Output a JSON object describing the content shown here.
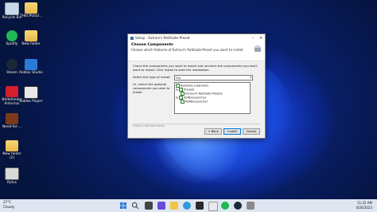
{
  "desktop": {
    "icons": [
      {
        "label": "Recycle Bin",
        "icon": "recycle-bin-icon"
      },
      {
        "label": "THECPUGU...",
        "icon": "folder-icon"
      },
      {
        "label": "Spotify",
        "icon": "spotify-icon"
      },
      {
        "label": "New folder",
        "icon": "folder-icon"
      },
      {
        "label": "Steam",
        "icon": "steam-icon"
      },
      {
        "label": "Roblox Studio",
        "icon": "roblox-studio-icon"
      },
      {
        "label": "Bitdefender Antivirus",
        "icon": "bitdefender-icon"
      },
      {
        "label": "Roblox Player",
        "icon": "roblox-player-icon"
      },
      {
        "label": "Need-for-...",
        "icon": "game-icon"
      },
      {
        "label": "New folder (2)",
        "icon": "folder-icon"
      },
      {
        "label": "Rufus",
        "icon": "rufus-icon"
      }
    ]
  },
  "dialog": {
    "title": "Setup - Extravi's ReShade-Preset",
    "header_title": "Choose Components",
    "header_subtitle": "Choose which features of Extravi's ReShade-Preset you want to install.",
    "instructions": "Check the components you want to install and uncheck the components you don't want to install. Click Install to start the installation.",
    "type_label": "Select the type of install:",
    "type_value": "Full",
    "optional_label": "Or, select the optional components you wish to install:",
    "components": [
      "ReShade (required)",
      "Presets",
      "Extravi's ReShade-Presets",
      "RoRbxLauncher",
      "RoRbxLauncher"
    ],
    "footer_text": "Extravi's ReShade-Preset",
    "back_label": "< Back",
    "install_label": "Install",
    "cancel_label": "Cancel"
  },
  "taskbar": {
    "weather_temp": "27°C",
    "weather_desc": "Cloudy",
    "time": "11:22 AM",
    "date": "4/26/2023"
  }
}
